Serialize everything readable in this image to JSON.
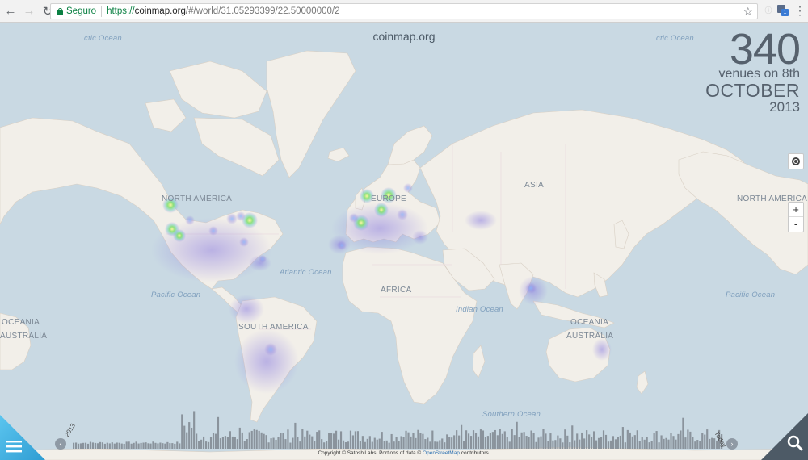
{
  "browser": {
    "secure_label": "Seguro",
    "url_scheme": "https://",
    "url_host": "coinmap.org",
    "url_path": "/#/world/31.05293399/22.50000000/2",
    "ext_badge": "1"
  },
  "site": {
    "title": "coinmap.org"
  },
  "counter": {
    "venues": "340",
    "line1": "venues on 8th",
    "line2": "OCTOBER",
    "line3": "2013"
  },
  "map_controls": {
    "zoom_in": "+",
    "zoom_out": "-"
  },
  "labels": {
    "ocean_arctic_left": "ctic Ocean",
    "ocean_arctic_right": "ctic Ocean",
    "north_america": "NORTH AMERICA",
    "north_america_right": "NORTH AMERICA",
    "europe": "EUROPE",
    "asia": "ASIA",
    "africa": "AFRICA",
    "south_america": "SOUTH AMERICA",
    "oceania_left": "OCEANIA",
    "australia_left": "AUSTRALIA",
    "oceania": "OCEANIA",
    "australia": "AUSTRALIA",
    "atlantic": "Atlantic Ocean",
    "pacific_left": "Pacific Ocean",
    "pacific_right": "Pacific Ocean",
    "indian": "Indian Ocean",
    "southern": "Southern Ocean"
  },
  "timeline": {
    "start_label": "2013",
    "end_label": "Today",
    "prev": "‹",
    "next": "›"
  },
  "attribution": {
    "text": "Copyright © SatoshiLabs. Portions of data © ",
    "osm": "OpenStreetMap",
    "suffix": " contributors."
  },
  "icons": {
    "back": "back-arrow-icon",
    "forward": "forward-arrow-icon",
    "reload": "reload-icon",
    "lock": "lock-icon",
    "star": "bookmark-star-icon",
    "menu": "hamburger-menu-icon",
    "search": "search-icon",
    "locate": "locate-icon"
  },
  "colors": {
    "accent_blue": "#3aa9d9",
    "corner_dark": "#4d5a66",
    "secure_green": "#0b8043",
    "heat_green": "#7ee06a",
    "heat_purple": "#8c7fe0"
  }
}
